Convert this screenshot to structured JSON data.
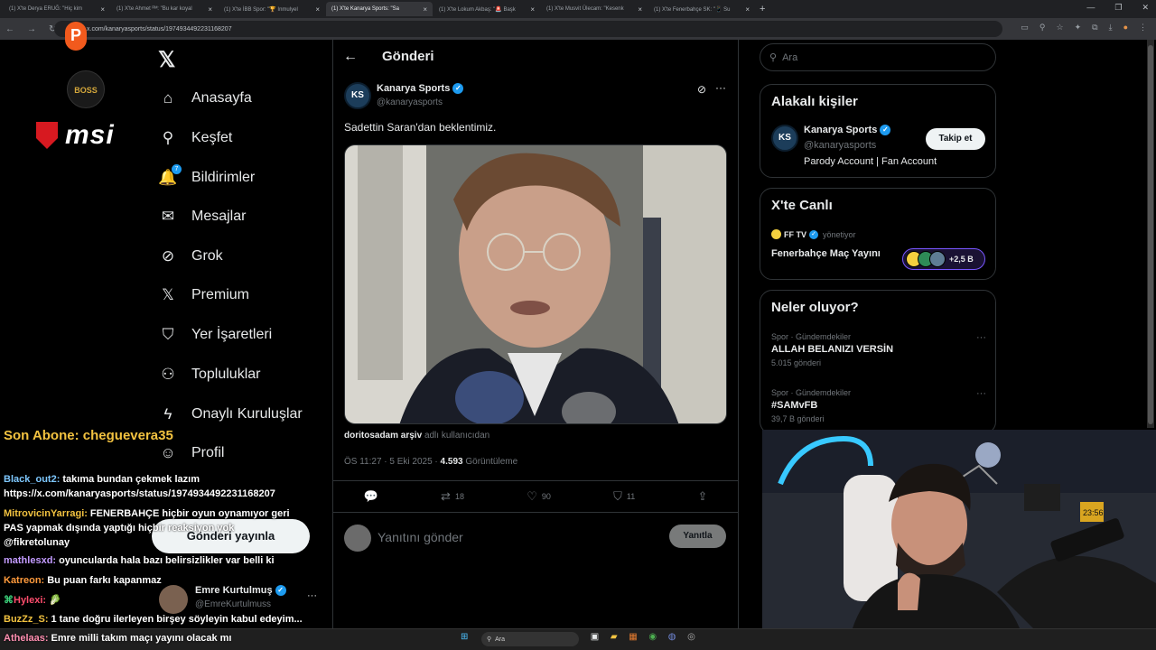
{
  "browser": {
    "tabs": [
      {
        "label": "(1) X'te Derya ERUĞ: \"Hiç kim"
      },
      {
        "label": "(1) X'te Ahmet ᴿᴹ: \"Bu kar koyal"
      },
      {
        "label": "(1) X'te İBB Spor: \"🏆 Inmulyel"
      },
      {
        "label": "(1) X'te Kanarya Sports: \"Sa"
      },
      {
        "label": "(1) X'te Lokum Akbaş: \"🚨 Başk"
      },
      {
        "label": "(1) X'te Musvit Ülecam: \"Kesenk"
      },
      {
        "label": "(1) X'te Fenerbahçe SK: \"📱 Su"
      }
    ],
    "url": "x.com/kanaryasports/status/1974934492231168207"
  },
  "overlay": {
    "p_badge": "P",
    "boss_logo": "BOSS",
    "msi": "msi"
  },
  "nav": {
    "items": [
      {
        "label": "Anasayfa",
        "icon": "home-icon",
        "glyph": "⌂"
      },
      {
        "label": "Keşfet",
        "icon": "search-icon",
        "glyph": "⚲"
      },
      {
        "label": "Bildirimler",
        "icon": "bell-icon",
        "glyph": "🔔"
      },
      {
        "label": "Mesajlar",
        "icon": "mail-icon",
        "glyph": "✉"
      },
      {
        "label": "Grok",
        "icon": "grok-icon",
        "glyph": "⊘"
      },
      {
        "label": "Premium",
        "icon": "x-premium-icon",
        "glyph": "𝕏"
      },
      {
        "label": "Yer İşaretleri",
        "icon": "bookmark-icon",
        "glyph": "🔖"
      },
      {
        "label": "Topluluklar",
        "icon": "communities-icon",
        "glyph": "👥"
      },
      {
        "label": "Onaylı Kuruluşlar",
        "icon": "lightning-icon",
        "glyph": "ϟ"
      },
      {
        "label": "Profil",
        "icon": "profile-icon",
        "glyph": "👤"
      }
    ],
    "post_button": "Gönderi yayınla",
    "notification_count": "7"
  },
  "profile": {
    "name": "Emre Kurtulmuş",
    "handle": "@EmreKurtulmuss"
  },
  "post": {
    "header_title": "Gönderi",
    "author_name": "Kanarya Sports",
    "author_handle": "@kanaryasports",
    "avatar_text": "KS",
    "text": "Sadettin Saran'dan beklentimiz.",
    "attribution_user": "doritosadam arşiv",
    "attribution_suffix": "adlı kullanıcıdan",
    "time": "ÖS 11:27 · 5 Eki 2025 · ",
    "views_count": "4.593",
    "views_label": " Görüntüleme",
    "reposts": "18",
    "likes": "90",
    "bookmarks": "11",
    "reply_placeholder": "Yanıtını gönder",
    "reply_button": "Yanıtla"
  },
  "right": {
    "search_placeholder": "Ara",
    "related_title": "Alakalı kişiler",
    "related_name": "Kanarya Sports",
    "related_handle": "@kanaryasports",
    "related_bio": "Parody Account | Fan Account",
    "follow_button": "Takip et",
    "live_title": "X'te Canlı",
    "live_host": "FF TV",
    "live_role": "yönetiyor",
    "live_stream_title": "Fenerbahçe Maç Yayını",
    "live_count": "+2,5 B",
    "trends_title": "Neler oluyor?",
    "trends": [
      {
        "category": "Spor · Gündemdekiler",
        "title": "ALLAH BELANIZI VERSİN",
        "count": "5.015 gönderi"
      },
      {
        "category": "Spor · Gündemdekiler",
        "title": "#SAMvFB",
        "count": "39,7 B gönderi"
      }
    ]
  },
  "stream": {
    "sub_label": "Son Abone: cheguevera35",
    "chat": [
      {
        "user": "Black_out2:",
        "text": "takıma bundan çekmek lazım",
        "color": "#7ec8ff"
      },
      {
        "user": "",
        "text": "https://x.com/kanaryasports/status/1974934492231168207",
        "color": "#ffffff"
      },
      {
        "user": "MitrovicinYarragi:",
        "text": "FENERBAHÇE hiçbir oyun oynamıyor geri",
        "color": "#f2c240"
      },
      {
        "user": "",
        "text": "PAS yapmak dışında yaptığı hiçbir reaksiyon yok",
        "color": "#ffffff"
      },
      {
        "user": "",
        "text": "@fikretolunay",
        "color": "#ffffff"
      },
      {
        "user": "mathlesxd:",
        "text": "oyuncularda hala bazı belirsizlikler var belli ki",
        "color": "#c39bff"
      },
      {
        "user": "Katreon:",
        "text": "Bu puan farkı kapanmaz",
        "color": "#ff9a3c"
      },
      {
        "user": "Hylexi:",
        "text": "🥬",
        "color": "#ff4d6d"
      },
      {
        "user": "BuzZz_S:",
        "text": "1 tane doğru ilerleyen birşey söyleyin kabul edeyim...",
        "color": "#f2c240"
      },
      {
        "user": "Athelaas:",
        "text": "Emre milli takım maçı yayını olacak mı",
        "color": "#ff8fb1"
      }
    ],
    "cam_clock": "23:56"
  },
  "taskbar": {
    "search": "Ara"
  },
  "colors": {
    "accent": "#1d9bf0",
    "brand_msi": "#d71920",
    "sub_gold": "#f2c240",
    "live_purple": "#7856ff"
  }
}
